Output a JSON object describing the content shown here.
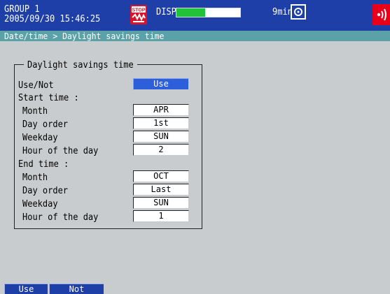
{
  "header": {
    "group": "GROUP 1",
    "datetime": "2005/09/30 15:46:25",
    "disp_label": "DISP",
    "time_remaining": "9min",
    "progress_fraction": 0.45,
    "icons": [
      "stop-icon",
      "media-icon",
      "alarm-icon"
    ]
  },
  "breadcrumb": "Date/time > Daylight savings time",
  "group_box": {
    "title": "Daylight savings time",
    "use_not": {
      "label": "Use/Not",
      "value": "Use"
    },
    "start_heading": "Start time :",
    "start": {
      "month": {
        "label": "Month",
        "value": "APR"
      },
      "day_order": {
        "label": "Day order",
        "value": "1st"
      },
      "weekday": {
        "label": "Weekday",
        "value": "SUN"
      },
      "hour": {
        "label": "Hour of the day",
        "value": "2"
      }
    },
    "end_heading": "End time   :",
    "end": {
      "month": {
        "label": "Month",
        "value": "OCT"
      },
      "day_order": {
        "label": "Day order",
        "value": "Last"
      },
      "weekday": {
        "label": "Weekday",
        "value": "SUN"
      },
      "hour": {
        "label": "Hour of the day",
        "value": "1"
      }
    }
  },
  "softkeys": {
    "use": "Use",
    "not": "Not"
  },
  "colors": {
    "header_bg": "#1e3fa8",
    "breadcrumb_bg": "#5aa2a8",
    "panel_bg": "#c9ccce",
    "selected_field": "#2d5fda",
    "progress_fill": "#22c13a",
    "alarm": "#e8001a"
  }
}
